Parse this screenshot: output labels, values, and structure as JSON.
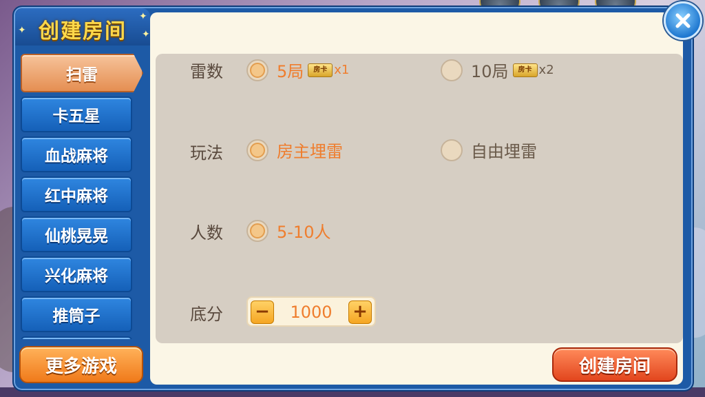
{
  "dialog": {
    "title": "创建房间"
  },
  "tabs": [
    {
      "label": "扫雷",
      "active": true
    },
    {
      "label": "卡五星"
    },
    {
      "label": "血战麻将"
    },
    {
      "label": "红中麻将"
    },
    {
      "label": "仙桃晃晃"
    },
    {
      "label": "兴化麻将"
    },
    {
      "label": "推筒子"
    }
  ],
  "options": {
    "rounds": {
      "label": "雷数",
      "choices": [
        {
          "text": "5局",
          "card": "房卡",
          "multiplier": "x1",
          "selected": true
        },
        {
          "text": "10局",
          "card": "房卡",
          "multiplier": "x2",
          "selected": false
        }
      ]
    },
    "mode": {
      "label": "玩法",
      "choices": [
        {
          "text": "房主埋雷",
          "selected": true
        },
        {
          "text": "自由埋雷",
          "selected": false
        }
      ]
    },
    "players": {
      "label": "人数",
      "choices": [
        {
          "text": "5-10人",
          "selected": true
        }
      ]
    },
    "base_score": {
      "label": "底分",
      "value": "1000",
      "minus": "−",
      "plus": "+"
    }
  },
  "buttons": {
    "more_games": "更多游戏",
    "create": "创建房间"
  },
  "colors": {
    "selected_text": "#ef7d2d",
    "tab_active": "#e58f52",
    "tab_inactive": "#1f6fcc"
  },
  "icons": {
    "close": "close-icon"
  }
}
